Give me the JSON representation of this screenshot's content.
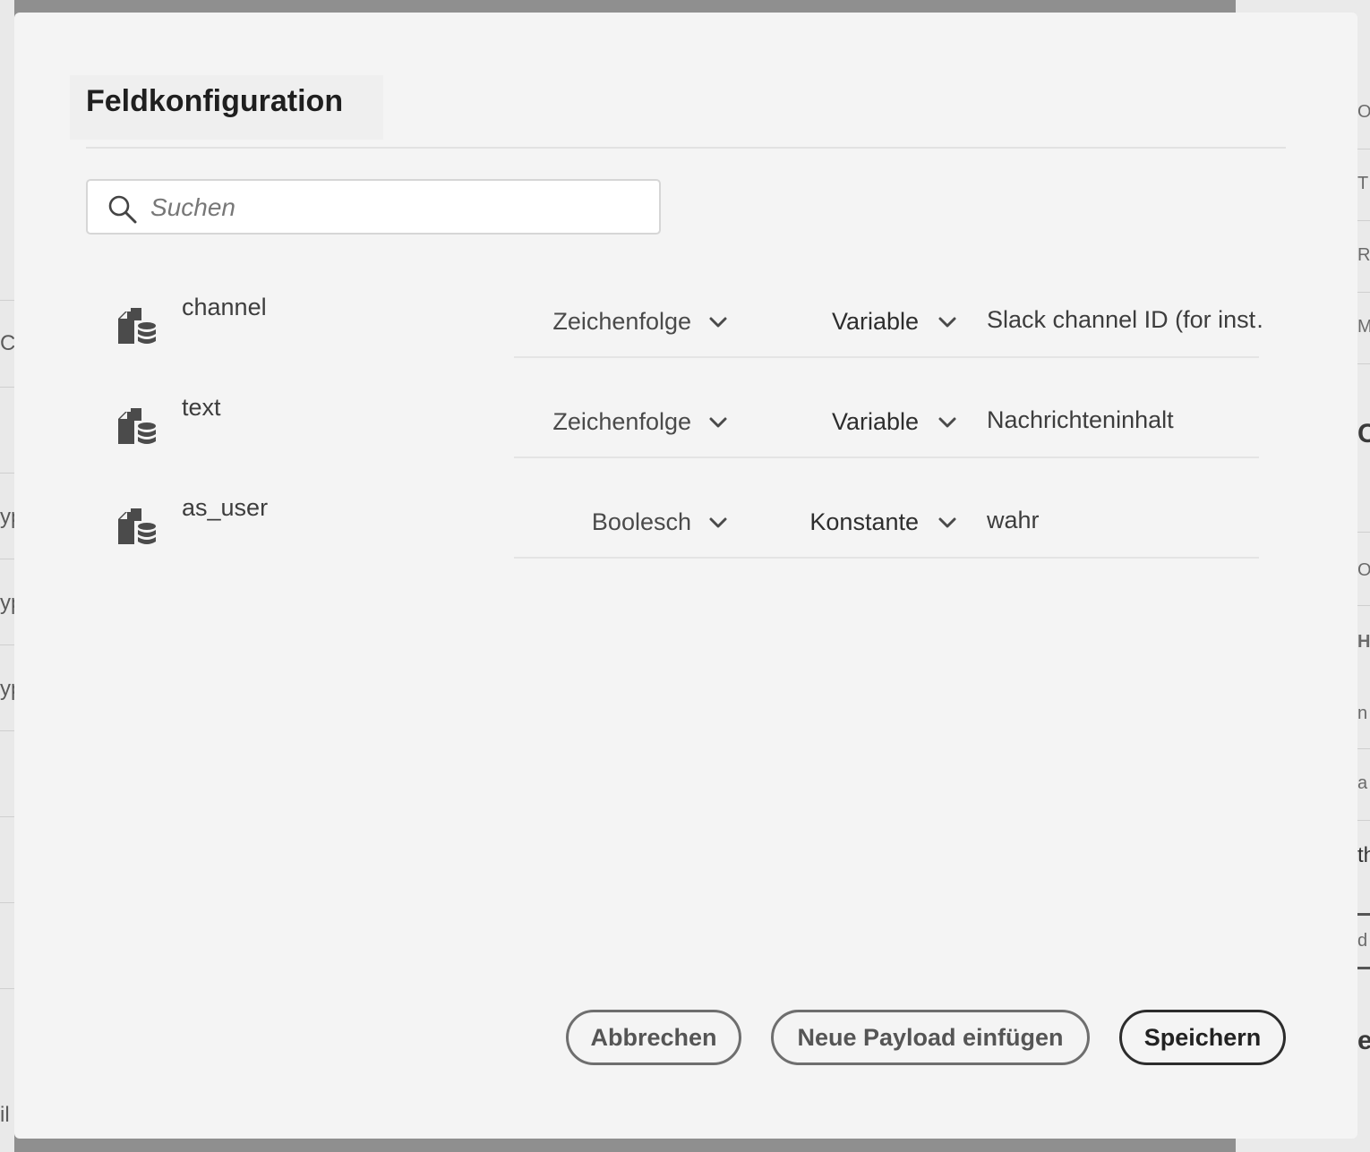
{
  "background": {
    "left_fragments": [
      "C",
      "yp",
      "yp",
      "yp",
      "il"
    ],
    "right_fragments": [
      "O",
      "TI",
      "RI",
      "M",
      "C",
      "O",
      "HE",
      "n",
      "a",
      "th",
      "d",
      "e"
    ]
  },
  "dialog": {
    "title": "Feldkonfiguration",
    "search": {
      "placeholder": "Suchen",
      "value": "",
      "icon": "search-icon"
    },
    "fields": [
      {
        "name": "channel",
        "type": "Zeichenfolge",
        "mode": "Variable",
        "value": "Slack channel ID (for inst…",
        "icon": "field-schema-icon"
      },
      {
        "name": "text",
        "type": "Zeichenfolge",
        "mode": "Variable",
        "value": "Nachrichteninhalt",
        "icon": "field-schema-icon"
      },
      {
        "name": "as_user",
        "type": "Boolesch",
        "mode": "Konstante",
        "value": "wahr",
        "icon": "field-schema-icon"
      }
    ],
    "buttons": {
      "cancel": "Abbrechen",
      "insert_payload": "Neue Payload einfügen",
      "save": "Speichern"
    }
  }
}
